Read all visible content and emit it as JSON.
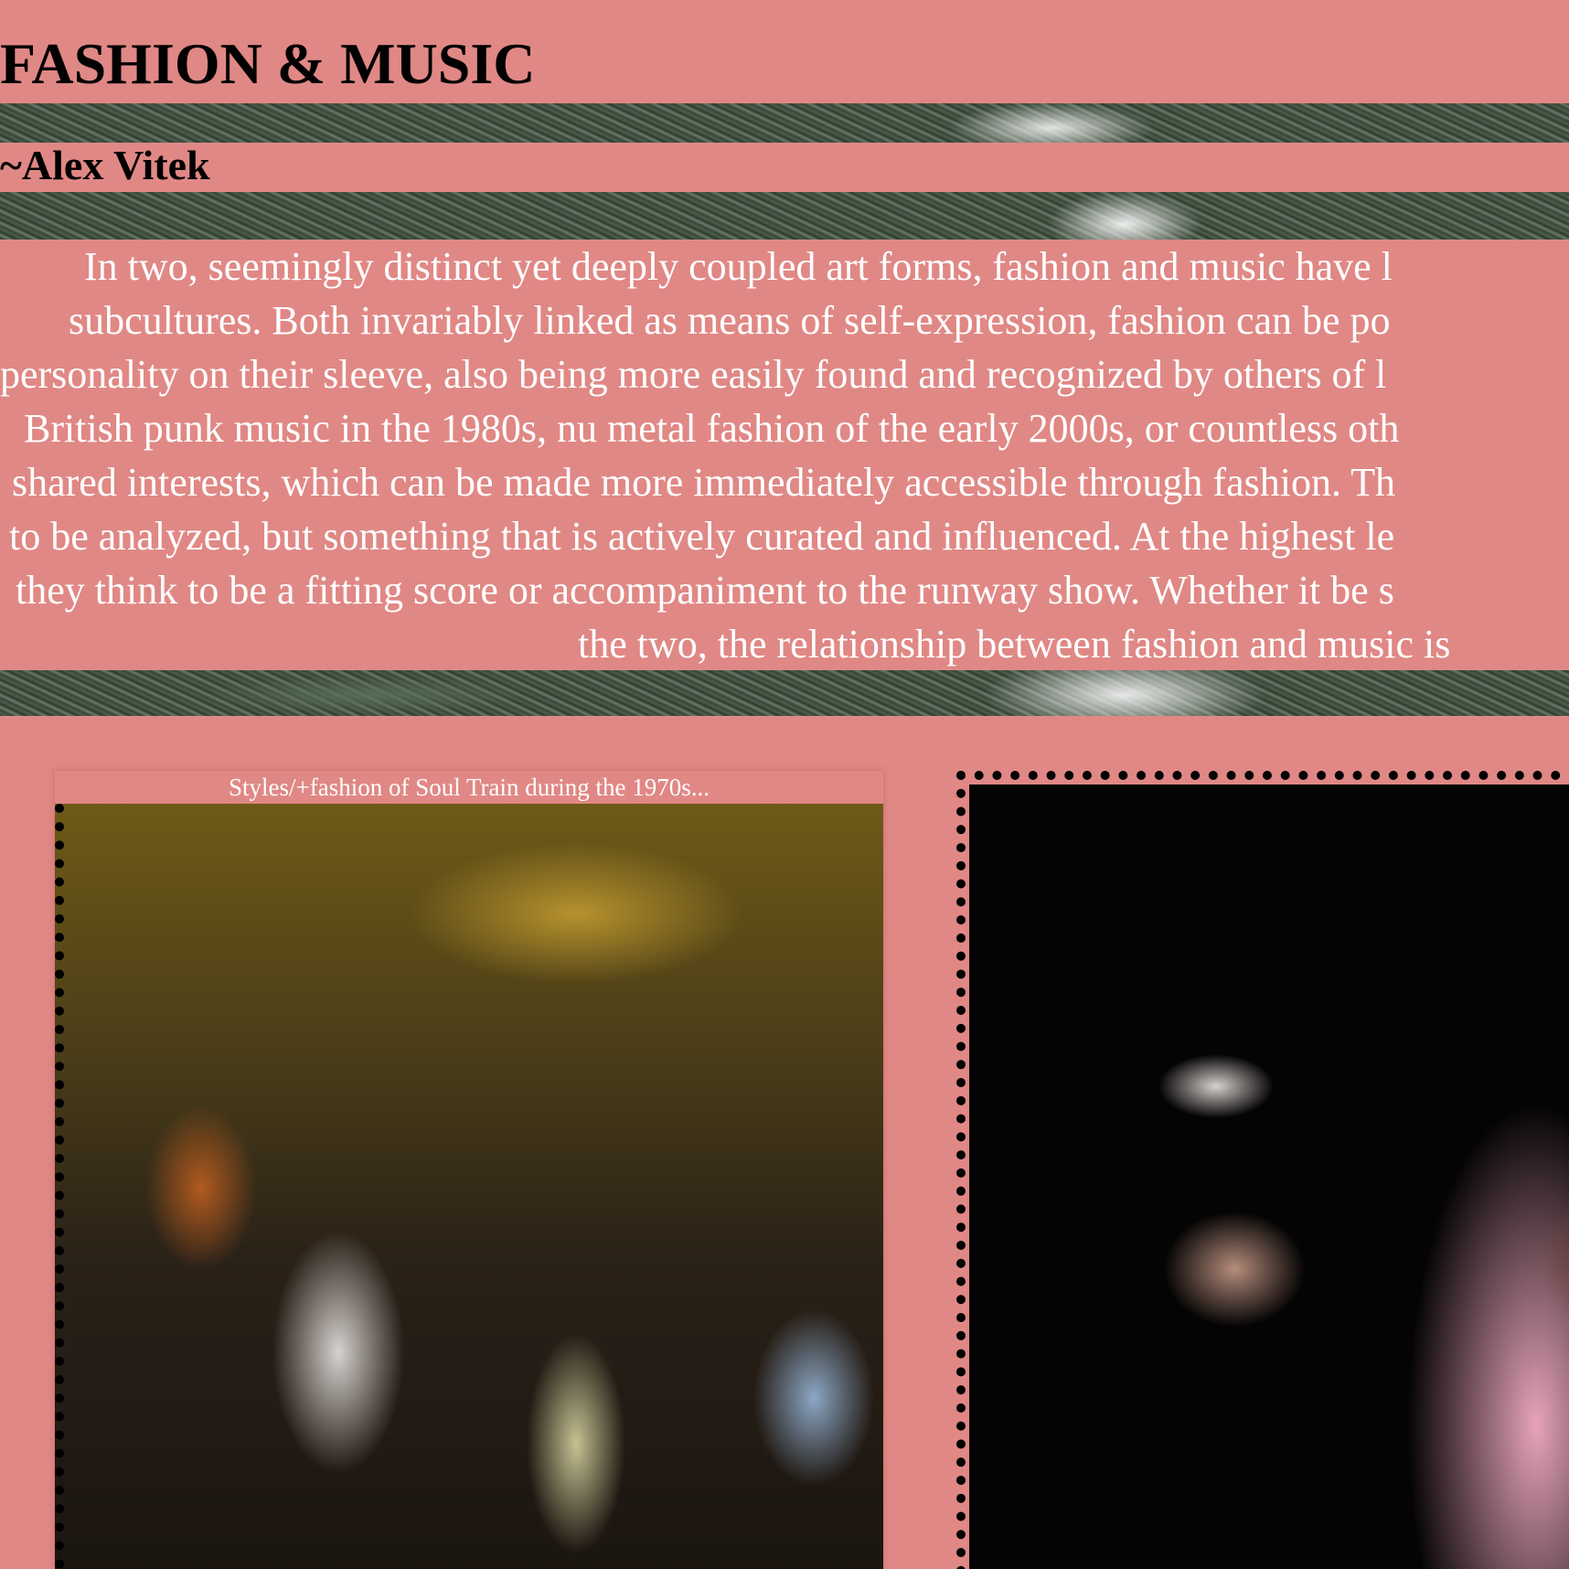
{
  "header": {
    "title": "FASHION & MUSIC",
    "byline": "~Alex Vitek"
  },
  "intro": {
    "lines": [
      "In two, seemingly distinct yet deeply coupled art forms, fashion and music have l",
      "subcultures. Both invariably linked as means of self-expression, fashion can be po",
      "personality on their sleeve, also being more easily found and recognized by others of l",
      "British punk music in the 1980s, nu metal fashion of the early 2000s, or countless oth",
      "shared interests, which can be made more immediately accessible through fashion. Th",
      "to be analyzed, but something that is actively curated and influenced. At the highest le",
      "they think to be a fitting score or accompaniment to the runway show. Whether it be s",
      "the two, the relationship between fashion and music is"
    ]
  },
  "gallery": {
    "cards": [
      {
        "caption": "Styles/+fashion of Soul Train during the 1970s..."
      }
    ]
  },
  "colors": {
    "background": "#e08885",
    "text_dark": "#000000",
    "text_light": "#ffffff"
  }
}
